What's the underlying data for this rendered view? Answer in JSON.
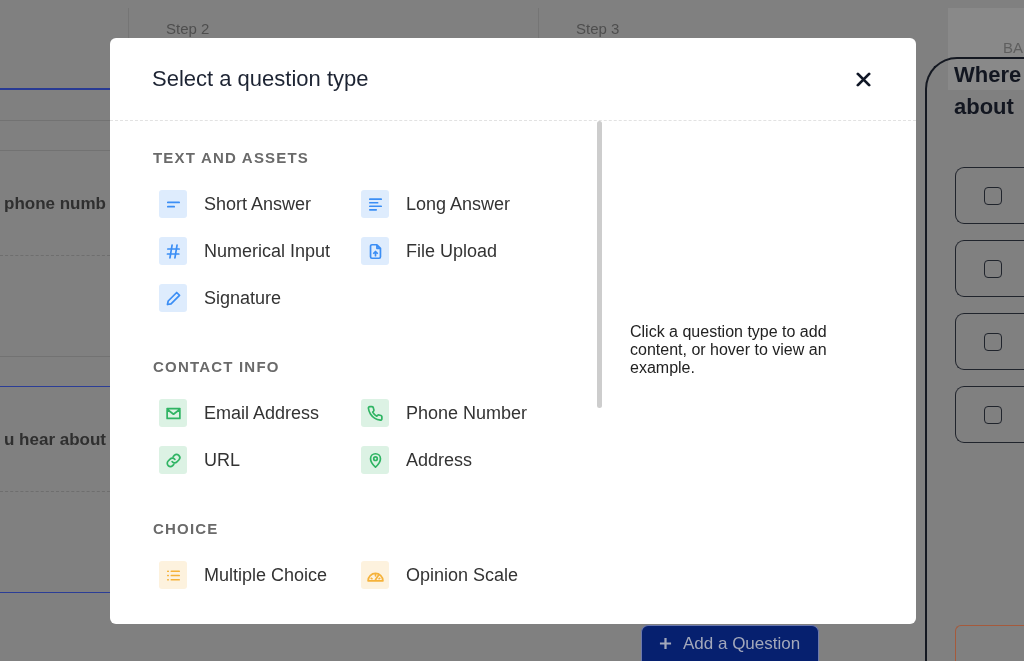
{
  "header": {
    "steps": [
      {
        "selected": true
      },
      {
        "label": "Step 2",
        "selected": false
      },
      {
        "label": "Step 3",
        "selected": false
      }
    ],
    "tab": "BA"
  },
  "questions": [
    {
      "title": "phone numb",
      "selected": false
    },
    {
      "title": "u hear about",
      "selected": true
    }
  ],
  "preview": {
    "title_lines": [
      "Where",
      "about"
    ],
    "options": [
      {
        "checked": false
      },
      {
        "checked": false
      },
      {
        "checked": false
      },
      {
        "checked": false
      }
    ]
  },
  "add_button": {
    "label": "Add a Question"
  },
  "modal": {
    "title": "Select a question type",
    "sections": [
      {
        "heading": "TEXT AND ASSETS",
        "color": "#3b8ef5",
        "items": [
          {
            "label": "Short Answer",
            "kind": "short"
          },
          {
            "label": "Long Answer",
            "kind": "long"
          },
          {
            "label": "Numerical Input",
            "kind": "number"
          },
          {
            "label": "File Upload",
            "kind": "upload"
          },
          {
            "label": "Signature",
            "kind": "signature"
          }
        ]
      },
      {
        "heading": "CONTACT INFO",
        "color": "#2fb463",
        "items": [
          {
            "label": "Email Address",
            "kind": "email"
          },
          {
            "label": "Phone Number",
            "kind": "phone"
          },
          {
            "label": "URL",
            "kind": "url"
          },
          {
            "label": "Address",
            "kind": "address"
          }
        ]
      },
      {
        "heading": "CHOICE",
        "color": "#f5b23a",
        "items": [
          {
            "label": "Multiple Choice",
            "kind": "list"
          },
          {
            "label": "Opinion Scale",
            "kind": "scale"
          }
        ]
      }
    ],
    "hint": "Click a question type to add content, or hover to view an example."
  }
}
